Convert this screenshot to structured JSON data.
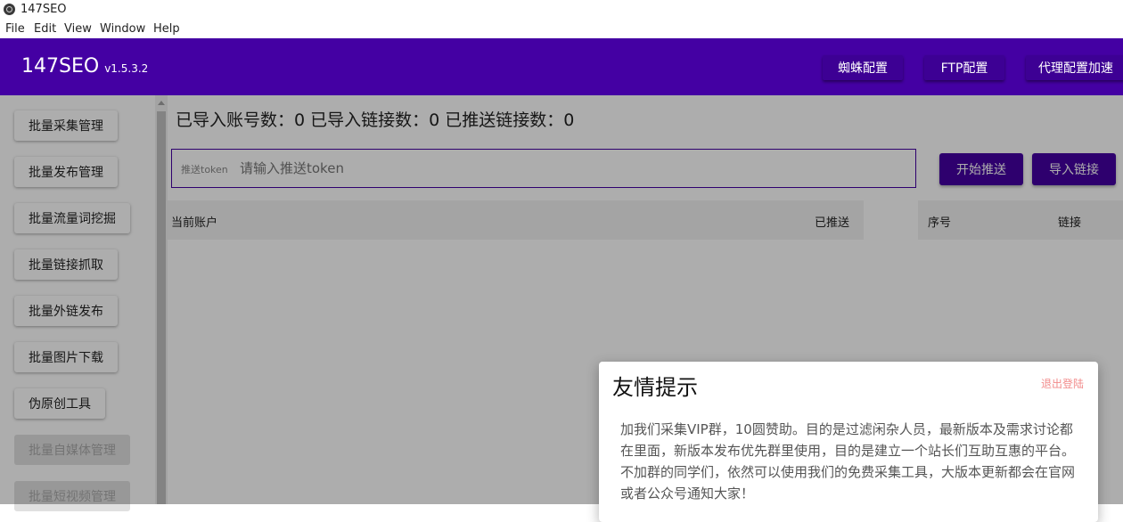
{
  "window": {
    "title": "147SEO"
  },
  "menu": [
    "File",
    "Edit",
    "View",
    "Window",
    "Help"
  ],
  "header": {
    "brand": "147SEO",
    "version": "v1.5.3.2",
    "buttons": [
      "蜘蛛配置",
      "FTP配置",
      "代理配置加速"
    ]
  },
  "sidebar": {
    "items": [
      {
        "label": "批量采集管理",
        "disabled": false
      },
      {
        "label": "批量发布管理",
        "disabled": false
      },
      {
        "label": "批量流量词挖掘",
        "disabled": false
      },
      {
        "label": "批量链接抓取",
        "disabled": false
      },
      {
        "label": "批量外链发布",
        "disabled": false
      },
      {
        "label": "批量图片下载",
        "disabled": false
      },
      {
        "label": "伪原创工具",
        "disabled": false
      },
      {
        "label": "批量自媒体管理",
        "disabled": true
      },
      {
        "label": "批量短视频管理",
        "disabled": true
      }
    ]
  },
  "main": {
    "stats": "已导入账号数：0 已导入链接数：0 已推送链接数：0",
    "token_label": "推送token",
    "token_placeholder": "请输入推送token",
    "start_push": "开始推送",
    "import_links": "导入链接",
    "table_left": {
      "col_account": "当前账户",
      "col_pushed": "已推送"
    },
    "table_right": {
      "col_index": "序号",
      "col_link": "链接"
    }
  },
  "dialog": {
    "title": "友情提示",
    "logout": "退出登陆",
    "body": "加我们采集VIP群，10圆赞助。目的是过滤闲杂人员，最新版本及需求讨论都在里面，新版本发布优先群里使用，目的是建立一个站长们互助互惠的平台。 不加群的同学们，依然可以使用我们的免费采集工具，大版本更新都会在官网或者公众号通知大家！"
  },
  "colors": {
    "brand": "#4400a3",
    "accent_link": "#f28b8b"
  }
}
